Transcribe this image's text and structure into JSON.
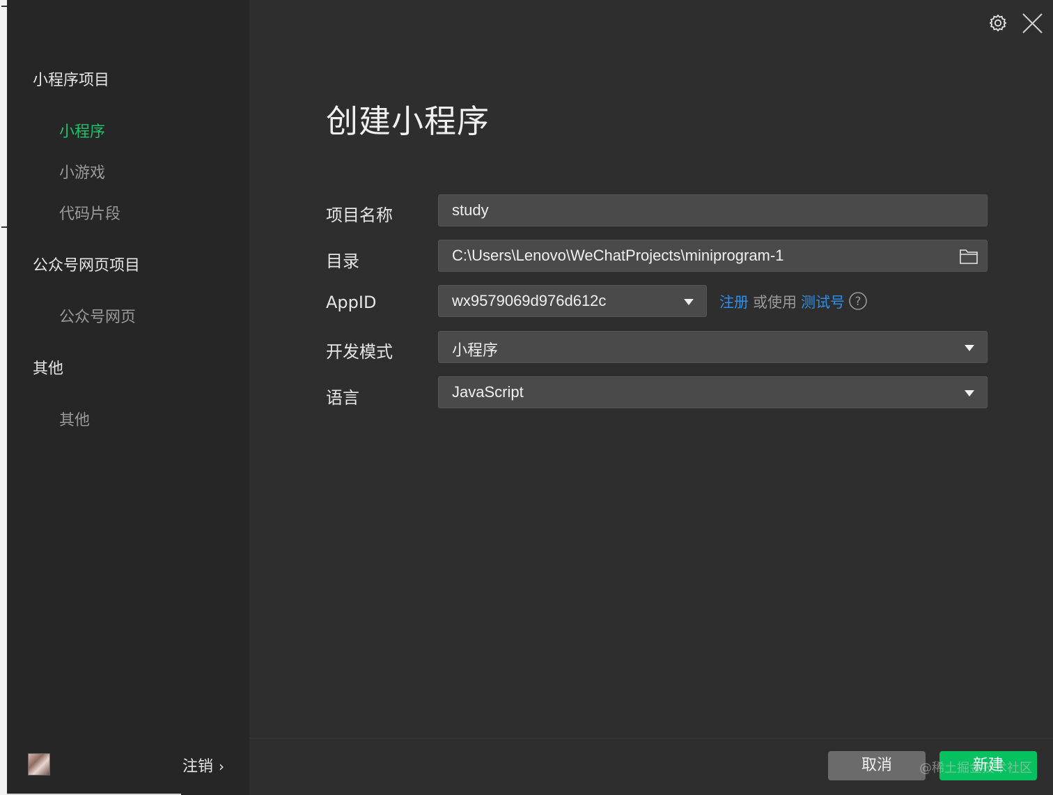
{
  "sidebar": {
    "groups": [
      {
        "title": "小程序项目",
        "items": [
          "小程序",
          "小游戏",
          "代码片段"
        ]
      },
      {
        "title": "公众号网页项目",
        "items": [
          "公众号网页"
        ]
      },
      {
        "title": "其他",
        "items": [
          "其他"
        ]
      }
    ],
    "active_item": "小程序",
    "logout_label": "注销"
  },
  "header_icons": [
    "gear-icon",
    "close-icon"
  ],
  "main": {
    "title": "创建小程序",
    "fields": {
      "project_name": {
        "label": "项目名称",
        "value": "study"
      },
      "directory": {
        "label": "目录",
        "value": "C:\\Users\\Lenovo\\WeChatProjects\\miniprogram-1"
      },
      "appid": {
        "label": "AppID",
        "value": "wx9579069d976d612c"
      },
      "dev_mode": {
        "label": "开发模式",
        "value": "小程序"
      },
      "language": {
        "label": "语言",
        "value": "JavaScript"
      }
    },
    "appid_links": {
      "register": "注册",
      "or_use": "或使用",
      "test_account": "测试号"
    }
  },
  "footer": {
    "cancel_label": "取消",
    "create_label": "新建",
    "watermark": "@稀土掘金技术社区"
  },
  "colors": {
    "accent_green": "#07c160",
    "active_text_green": "#1fc16b",
    "link_blue": "#2e8ee8",
    "panel_bg": "#2e2e2e",
    "sidebar_bg": "#262626"
  }
}
